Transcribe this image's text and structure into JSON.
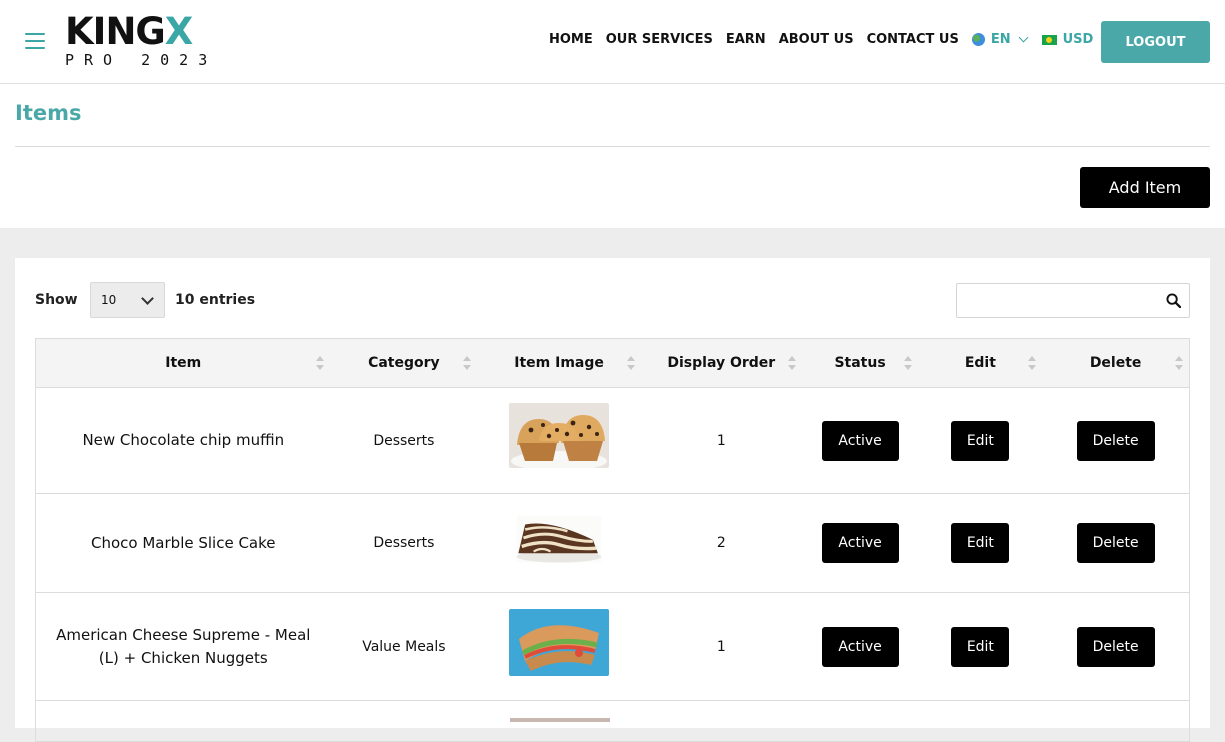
{
  "header": {
    "logo_main": "KING",
    "logo_x": "X",
    "logo_sub": "PRO 2023",
    "nav": [
      "HOME",
      "OUR SERVICES",
      "EARN",
      "ABOUT US",
      "CONTACT US"
    ],
    "language": "EN",
    "currency": "USD",
    "logout_label": "LOGOUT"
  },
  "page": {
    "title": "Items",
    "add_button": "Add Item"
  },
  "table_controls": {
    "show_label": "Show",
    "page_length": "10",
    "entries_label": "10 entries",
    "search_value": ""
  },
  "table": {
    "columns": [
      "Item",
      "Category",
      "Item Image",
      "Display Order",
      "Status",
      "Edit",
      "Delete"
    ],
    "rows": [
      {
        "item": "New Chocolate chip muffin",
        "category": "Desserts",
        "image": "muffin-image",
        "order": "1",
        "status": "Active",
        "edit": "Edit",
        "delete": "Delete"
      },
      {
        "item": "Choco Marble Slice Cake",
        "category": "Desserts",
        "image": "marble-cake-image",
        "order": "2",
        "status": "Active",
        "edit": "Edit",
        "delete": "Delete"
      },
      {
        "item": "American Cheese Supreme - Meal (L) + Chicken Nuggets",
        "category": "Value Meals",
        "image": "sandwich-image",
        "order": "1",
        "status": "Active",
        "edit": "Edit",
        "delete": "Delete"
      }
    ]
  },
  "colors": {
    "accent": "#4aa9a8",
    "button_dark": "#000000",
    "page_bg": "#ededed"
  }
}
